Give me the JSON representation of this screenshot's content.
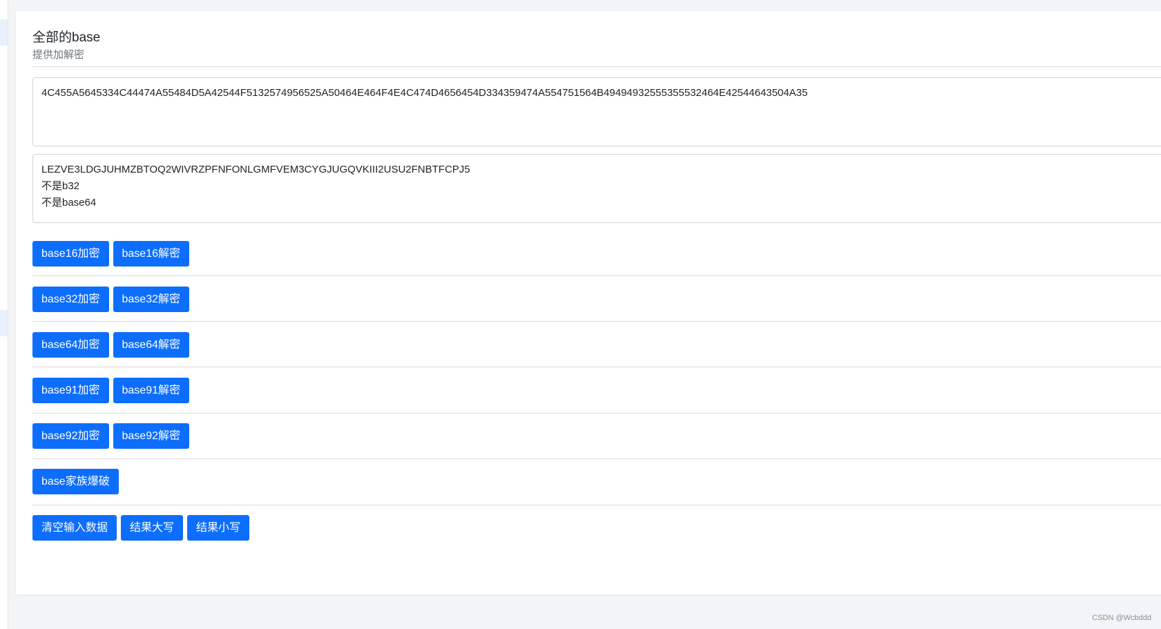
{
  "panel": {
    "title": "全部的base",
    "subtitle": "提供加解密"
  },
  "input": {
    "value": "4C455A5645334C44474A55484D5A42544F5132574956525A50464E464F4E4C474D4656454D334359474A554751564B49494932555355532464E42544643504A35"
  },
  "output": {
    "value": "LEZVE3LDGJUHMZBTOQ2WIVRZPFNFONLGMFVEM3CYGJUGQVKIII2USU2FNBTFCPJ5\n不是b32\n不是base64"
  },
  "buttons": {
    "base16_encode": "base16加密",
    "base16_decode": "base16解密",
    "base32_encode": "base32加密",
    "base32_decode": "base32解密",
    "base64_encode": "base64加密",
    "base64_decode": "base64解密",
    "base91_encode": "base91加密",
    "base91_decode": "base91解密",
    "base92_encode": "base92加密",
    "base92_decode": "base92解密",
    "brute_force": "base家族爆破",
    "clear_input": "清空输入数据",
    "result_upper": "结果大写",
    "result_lower": "结果小写"
  },
  "watermark": "CSDN @Wcbddd",
  "colors": {
    "accent": "#0d6efd",
    "page_bg": "#f3f4f6",
    "divider": "#d9dbde"
  }
}
